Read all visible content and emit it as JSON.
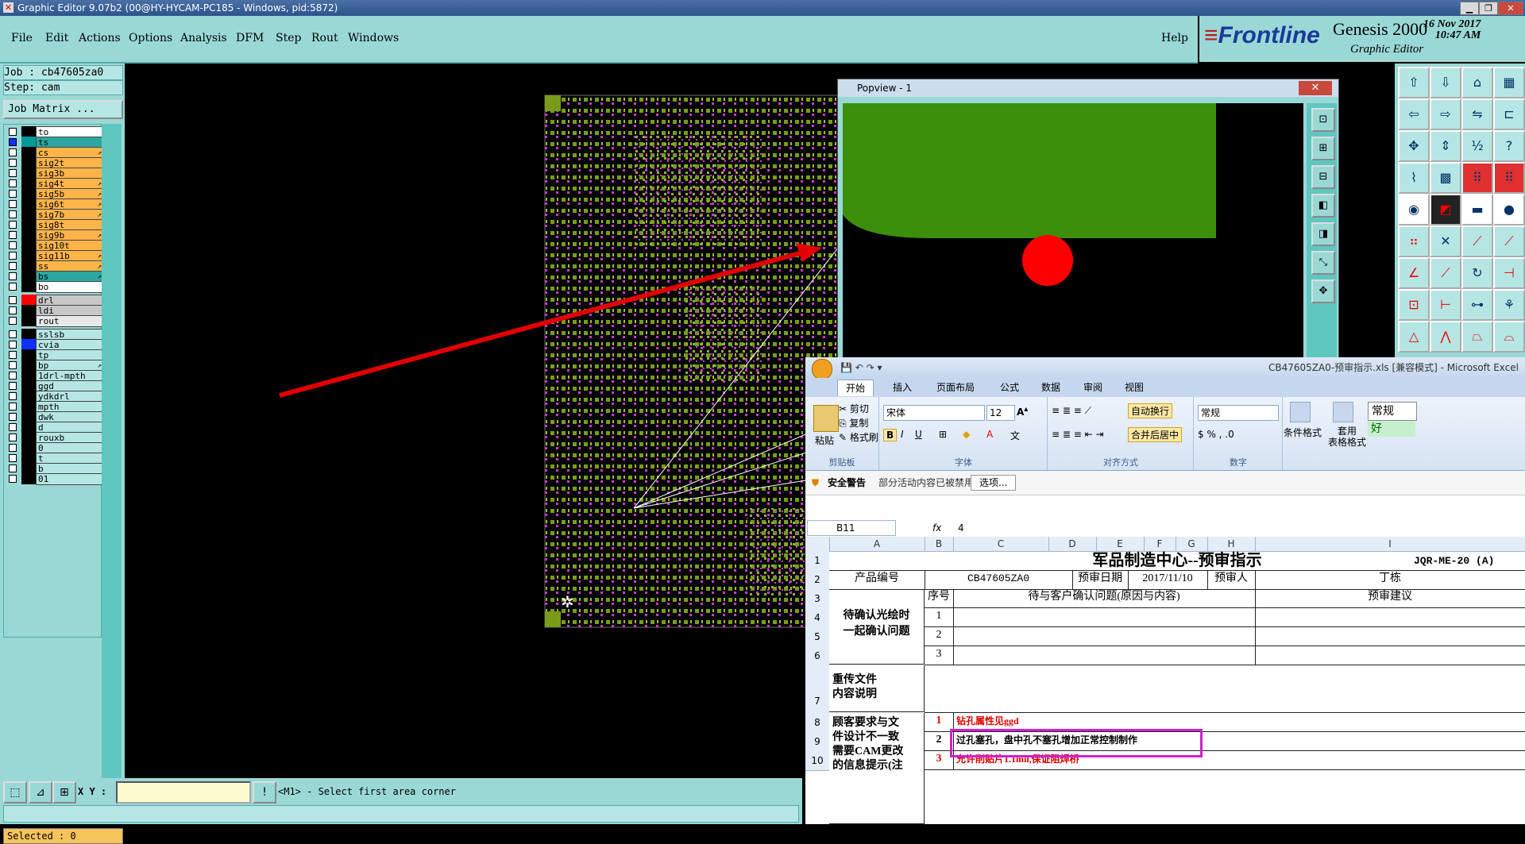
{
  "window": {
    "title": "Graphic Editor 9.07b2 (00@HY-HYCAM-PC185 - Windows, pid:5872)"
  },
  "menu": {
    "items": [
      "File",
      "Edit",
      "Actions",
      "Options",
      "Analysis",
      "DFM",
      "Step",
      "Rout",
      "Windows"
    ],
    "help": "Help"
  },
  "brand": {
    "logo": "Frontline",
    "product": "Genesis 2000",
    "subtitle": "Graphic Editor",
    "date": "16 Nov 2017",
    "time": "10:47 AM"
  },
  "job": {
    "job_line": "Job : cb47605za0",
    "step_line": "Step: cam",
    "matrix_button": "Job Matrix ..."
  },
  "layers": [
    {
      "name": "to",
      "color": "#ffffff",
      "swatch": "#000000",
      "marker": ""
    },
    {
      "name": "ts",
      "color": "#2aa7a0",
      "swatch": "#009999",
      "marker": "",
      "active": true
    },
    {
      "name": "cs",
      "color": "#ffb44a",
      "swatch": "#000000",
      "marker": "↗"
    },
    {
      "name": "sig2t",
      "color": "#ffb44a",
      "swatch": "#000000",
      "marker": ""
    },
    {
      "name": "sig3b",
      "color": "#ffb44a",
      "swatch": "#000000",
      "marker": ""
    },
    {
      "name": "sig4t",
      "color": "#ffb44a",
      "swatch": "#000000",
      "marker": "↗"
    },
    {
      "name": "sig5b",
      "color": "#ffb44a",
      "swatch": "#000000",
      "marker": "↗"
    },
    {
      "name": "sig6t",
      "color": "#ffb44a",
      "swatch": "#000000",
      "marker": "↗"
    },
    {
      "name": "sig7b",
      "color": "#ffb44a",
      "swatch": "#000000",
      "marker": "↗"
    },
    {
      "name": "sig8t",
      "color": "#ffb44a",
      "swatch": "#000000",
      "marker": ""
    },
    {
      "name": "sig9b",
      "color": "#ffb44a",
      "swatch": "#000000",
      "marker": "↗"
    },
    {
      "name": "sig10t",
      "color": "#ffb44a",
      "swatch": "#000000",
      "marker": ""
    },
    {
      "name": "sig11b",
      "color": "#ffb44a",
      "swatch": "#000000",
      "marker": "↗"
    },
    {
      "name": "ss",
      "color": "#ffb44a",
      "swatch": "#000000",
      "marker": "↗"
    },
    {
      "name": "bs",
      "color": "#2aa7a0",
      "swatch": "#000000",
      "marker": "↗"
    },
    {
      "name": "bo",
      "color": "#ffffff",
      "swatch": "#000000",
      "marker": ""
    },
    {
      "name": "drl",
      "color": "#c7c7c7",
      "swatch": "#ff0000",
      "marker": ""
    },
    {
      "name": "ldi",
      "color": "#c7c7c7",
      "swatch": "#000000",
      "marker": ""
    },
    {
      "name": "rout",
      "color": "#e8e8e8",
      "swatch": "#000000",
      "marker": ""
    },
    {
      "name": "sslsb",
      "color": "#b5e6e4",
      "swatch": "#000000",
      "marker": ""
    },
    {
      "name": "cvia",
      "color": "#b5e6e4",
      "swatch": "#1030ff",
      "marker": ""
    },
    {
      "name": "tp",
      "color": "#b5e6e4",
      "swatch": "#000000",
      "marker": ""
    },
    {
      "name": "bp",
      "color": "#b5e6e4",
      "swatch": "#000000",
      "marker": "↗"
    },
    {
      "name": "1drl-mpth",
      "color": "#b5e6e4",
      "swatch": "#000000",
      "marker": ""
    },
    {
      "name": "ggd",
      "color": "#b5e6e4",
      "swatch": "#000000",
      "marker": ""
    },
    {
      "name": "ydkdrl",
      "color": "#b5e6e4",
      "swatch": "#000000",
      "marker": ""
    },
    {
      "name": "mpth",
      "color": "#b5e6e4",
      "swatch": "#000000",
      "marker": ""
    },
    {
      "name": "dwk",
      "color": "#b5e6e4",
      "swatch": "#000000",
      "marker": ""
    },
    {
      "name": "d",
      "color": "#b5e6e4",
      "swatch": "#000000",
      "marker": ""
    },
    {
      "name": "rouxb",
      "color": "#b5e6e4",
      "swatch": "#000000",
      "marker": ""
    },
    {
      "name": "0",
      "color": "#b5e6e4",
      "swatch": "#000000",
      "marker": ""
    },
    {
      "name": "t",
      "color": "#b5e6e4",
      "swatch": "#000000",
      "marker": ""
    },
    {
      "name": "b",
      "color": "#b5e6e4",
      "swatch": "#000000",
      "marker": ""
    },
    {
      "name": "01",
      "color": "#b5e6e4",
      "swatch": "#000000",
      "marker": ""
    }
  ],
  "status": {
    "selected": "Selected : 0",
    "xy_label": "X Y :",
    "prompt": "<M1> - Select first area corner"
  },
  "popview": {
    "title": "Popview - 1",
    "close": "✕"
  },
  "excel": {
    "title": "CB47605ZA0-预审指示.xls  [兼容模式] - Microsoft Excel",
    "tabs": [
      "开始",
      "插入",
      "页面布局",
      "公式",
      "数据",
      "审阅",
      "视图"
    ],
    "ribbon": {
      "clipboard": {
        "label": "剪贴板",
        "paste": "粘贴",
        "cut": "剪切",
        "copy": "复制",
        "format": "格式刷"
      },
      "font": {
        "label": "字体",
        "name": "宋体",
        "size": "12"
      },
      "align": {
        "label": "对齐方式",
        "wrap": "自动换行",
        "merge": "合并后居中"
      },
      "number": {
        "label": "数字",
        "format": "常规"
      },
      "styles": {
        "cond": "条件格式",
        "table": "套用\n表格格式",
        "normal": "常规",
        "good": "好"
      }
    },
    "warning": {
      "title": "安全警告",
      "text": "部分活动内容已被禁用。",
      "button": "选项..."
    },
    "namebox": "B11",
    "fx": "fx",
    "formula": "4",
    "columns": [
      "A",
      "B",
      "C",
      "D",
      "E",
      "F",
      "G",
      "H",
      "I"
    ],
    "rows": [
      "1",
      "2",
      "3",
      "4",
      "5",
      "6",
      "7",
      "8",
      "9",
      "10"
    ],
    "sheet": {
      "title": "军品制造中心--预审指示",
      "code": "JQR-ME-20 (A)",
      "product_label": "产品编号",
      "product_value": "CB47605ZA0",
      "date_label": "预审日期",
      "date_value": "2017/11/10",
      "reviewer_label": "预审人",
      "reviewer_value": "丁栋",
      "seq_label": "序号",
      "issue_label": "待与客户确认问题(原因与内容)",
      "advice_label": "预审建议",
      "confirm_label": "待确认光绘时\n一起确认问题",
      "seq": [
        "1",
        "2",
        "3"
      ],
      "reupload_label": "重传文件\n内容说明",
      "diff_label": "顾客要求与文\n件设计不一致\n需要CAM更改\n的信息提示(注",
      "diff_rows": [
        {
          "n": "1",
          "t": "钻孔属性见ggd"
        },
        {
          "n": "2",
          "t": "过孔塞孔，盘中孔不塞孔增加正常控制制作"
        },
        {
          "n": "3",
          "t": "允许削贴片1.1mil,保证阻焊桥"
        }
      ]
    }
  }
}
